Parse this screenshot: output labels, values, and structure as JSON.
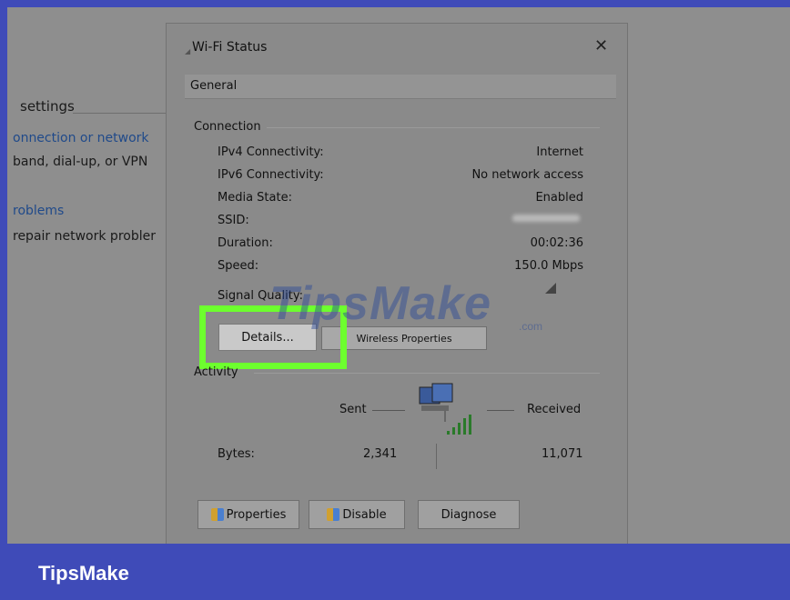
{
  "background": {
    "heading": "settings",
    "link_connection": "onnection or network",
    "text_broadband": "band, dial-up, or VPN",
    "link_problems": "roblems",
    "text_repair": "repair network probler"
  },
  "dialog": {
    "title": "Wi-Fi Status",
    "close_glyph": "✕",
    "tab": "General",
    "connection": {
      "label": "Connection",
      "rows": [
        {
          "label": "IPv4 Connectivity:",
          "value": "Internet"
        },
        {
          "label": "IPv6 Connectivity:",
          "value": "No network access"
        },
        {
          "label": "Media State:",
          "value": "Enabled"
        },
        {
          "label": "SSID:",
          "value": ""
        },
        {
          "label": "Duration:",
          "value": "00:02:36"
        },
        {
          "label": "Speed:",
          "value": "150.0 Mbps"
        }
      ],
      "signal_label": "Signal Quality:"
    },
    "details_button": "Details...",
    "wireless_button": "Wireless Properties",
    "activity": {
      "label": "Activity",
      "sent_label": "Sent",
      "received_label": "Received",
      "bytes_label": "Bytes:",
      "sent_value": "2,341",
      "received_value": "11,071"
    },
    "buttons": {
      "properties": "Properties",
      "disable": "Disable",
      "diagnose": "Diagnose"
    }
  },
  "watermark": {
    "text": "TipsMake",
    "suffix": ".com"
  },
  "footer": {
    "brand": "TipsMake"
  },
  "colors": {
    "frame": "#3f4bb8",
    "highlight": "#6dff2e"
  }
}
